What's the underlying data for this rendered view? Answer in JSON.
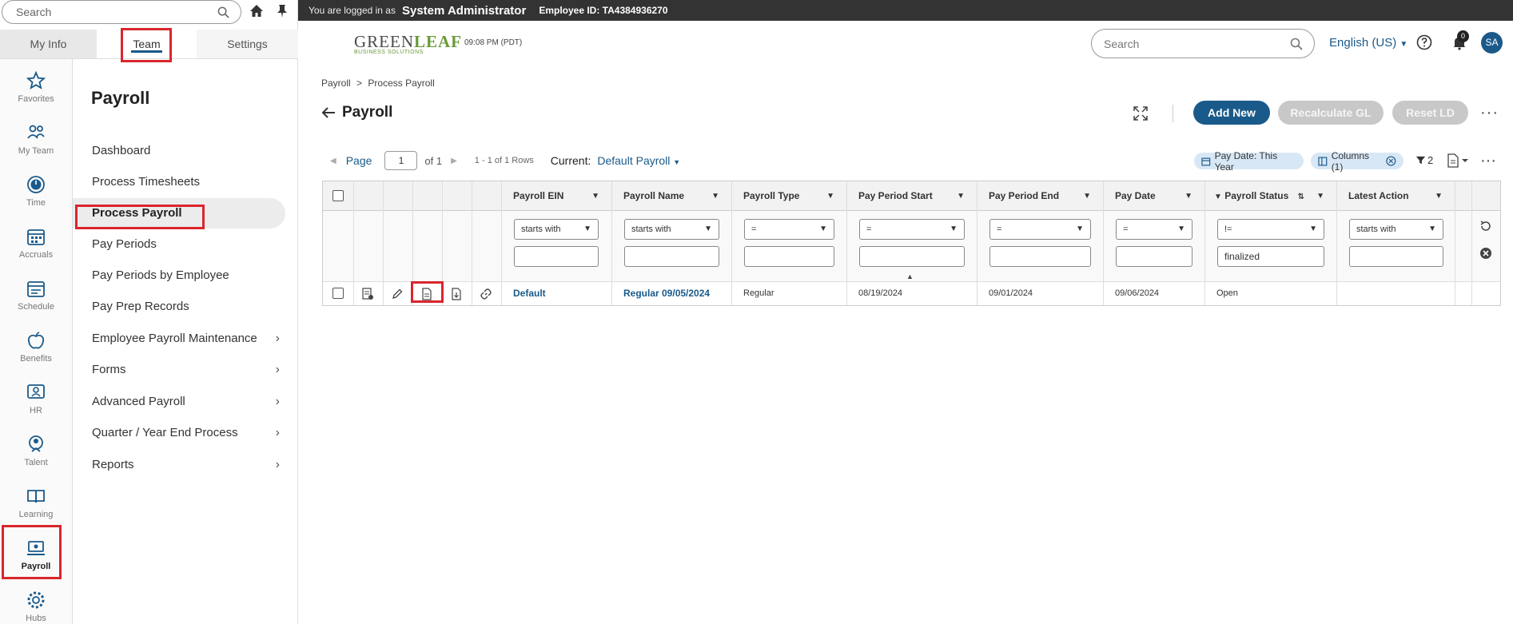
{
  "left_search": {
    "placeholder": "Search"
  },
  "mode_tabs": {
    "my_info": "My Info",
    "team": "Team",
    "settings": "Settings"
  },
  "rail": [
    {
      "label": "Favorites",
      "icon": "star-icon"
    },
    {
      "label": "My Team",
      "icon": "team-icon"
    },
    {
      "label": "Time",
      "icon": "clock-icon"
    },
    {
      "label": "Accruals",
      "icon": "calendar-grid-icon"
    },
    {
      "label": "Schedule",
      "icon": "schedule-icon"
    },
    {
      "label": "Benefits",
      "icon": "apple-icon"
    },
    {
      "label": "HR",
      "icon": "hr-icon"
    },
    {
      "label": "Talent",
      "icon": "talent-icon"
    },
    {
      "label": "Learning",
      "icon": "book-icon"
    },
    {
      "label": "Payroll",
      "icon": "payroll-icon"
    },
    {
      "label": "Hubs",
      "icon": "gear-icon"
    }
  ],
  "nav": {
    "title": "Payroll",
    "items": [
      {
        "label": "Dashboard",
        "chevron": false
      },
      {
        "label": "Process Timesheets",
        "chevron": false
      },
      {
        "label": "Process Payroll",
        "chevron": false,
        "active": true
      },
      {
        "label": "Pay Periods",
        "chevron": false
      },
      {
        "label": "Pay Periods by Employee",
        "chevron": false
      },
      {
        "label": "Pay Prep Records",
        "chevron": false
      },
      {
        "label": "Employee Payroll Maintenance",
        "chevron": true
      },
      {
        "label": "Forms",
        "chevron": true
      },
      {
        "label": "Advanced Payroll",
        "chevron": true
      },
      {
        "label": "Quarter / Year End Process",
        "chevron": true
      },
      {
        "label": "Reports",
        "chevron": true
      }
    ]
  },
  "topbar": {
    "logged_in_as": "You are logged in as",
    "user": "System Administrator",
    "employee_id": "Employee ID: TA4384936270"
  },
  "header": {
    "logo_main_1": "GREEN",
    "logo_main_2": "LEAF",
    "logo_sub": "BUSINESS SOLUTIONS",
    "time": "09:08 PM (PDT)",
    "search_placeholder": "Search",
    "language": "English (US)",
    "notifications": "0",
    "avatar": "SA"
  },
  "breadcrumb": {
    "root": "Payroll",
    "sep": ">",
    "current": "Process Payroll"
  },
  "page": {
    "title": "Payroll",
    "add_new": "Add New",
    "recalculate_gl": "Recalculate GL",
    "reset_ld": "Reset LD"
  },
  "pager": {
    "page_label": "Page",
    "page_value": "1",
    "of": "of 1",
    "rows": "1 - 1 of 1 Rows",
    "current_label": "Current:",
    "current_value": "Default Payroll"
  },
  "chips": {
    "pay_date": "Pay Date: This Year",
    "columns": "Columns (1)",
    "filter_count": "2"
  },
  "grid": {
    "columns": [
      {
        "label": "Payroll EIN",
        "op": "starts with",
        "value": ""
      },
      {
        "label": "Payroll Name",
        "op": "starts with",
        "value": ""
      },
      {
        "label": "Payroll Type",
        "op": "=",
        "value": ""
      },
      {
        "label": "Pay Period Start",
        "op": "=",
        "value": ""
      },
      {
        "label": "Pay Period End",
        "op": "=",
        "value": ""
      },
      {
        "label": "Pay Date",
        "op": "=",
        "value": ""
      },
      {
        "label": "Payroll Status",
        "op": "!=",
        "value": "finalized"
      },
      {
        "label": "Latest Action",
        "op": "starts with",
        "value": ""
      }
    ],
    "row": [
      "Default",
      "Regular 09/05/2024",
      "Regular",
      "08/19/2024",
      "09/01/2024",
      "09/06/2024",
      "Open",
      ""
    ]
  },
  "colors": {
    "accent": "#1a5a8a",
    "highlight": "#d9262c",
    "topbar": "#333333",
    "chip": "#d7e7f5"
  }
}
